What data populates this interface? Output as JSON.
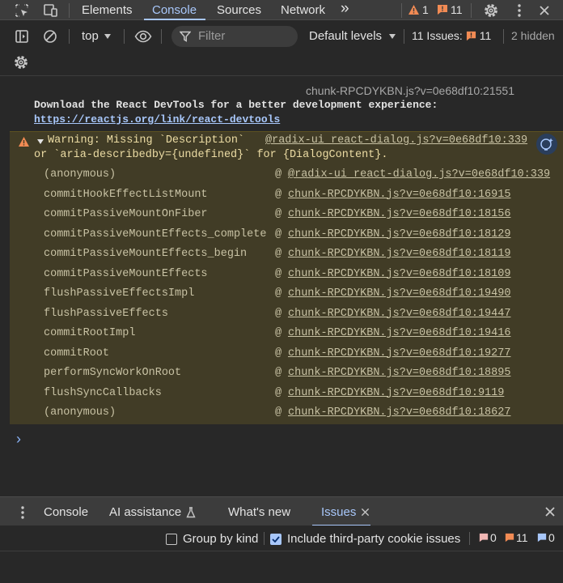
{
  "topbar": {
    "tabs": [
      {
        "label": "Elements"
      },
      {
        "label": "Console"
      },
      {
        "label": "Sources"
      },
      {
        "label": "Network"
      }
    ],
    "warning_count": "1",
    "issue_count": "11"
  },
  "console_toolbar": {
    "context": "top",
    "filter_placeholder": "Filter",
    "levels": "Default levels",
    "issues_label": "11 Issues:",
    "issues_count": "11",
    "hidden": "2 hidden"
  },
  "log": {
    "react_source": "chunk-RPCDYKBN.js?v=0e68df10:21551",
    "react_msg": "Download the React DevTools for a better development experience:",
    "react_link": "https://reactjs.org/link/react-devtools",
    "warning": {
      "line1": "Warning: Missing `Description`",
      "line2": "or `aria-describedby={undefined}` for {DialogContent}.",
      "source": "@radix-ui_react-dialog.js?v=0e68df10:339",
      "frames": [
        {
          "fn": "(anonymous)",
          "url": "@radix-ui_react-dialog.js?v=0e68df10:339"
        },
        {
          "fn": "commitHookEffectListMount",
          "url": "chunk-RPCDYKBN.js?v=0e68df10:16915"
        },
        {
          "fn": "commitPassiveMountOnFiber",
          "url": "chunk-RPCDYKBN.js?v=0e68df10:18156"
        },
        {
          "fn": "commitPassiveMountEffects_complete",
          "url": "chunk-RPCDYKBN.js?v=0e68df10:18129"
        },
        {
          "fn": "commitPassiveMountEffects_begin",
          "url": "chunk-RPCDYKBN.js?v=0e68df10:18119"
        },
        {
          "fn": "commitPassiveMountEffects",
          "url": "chunk-RPCDYKBN.js?v=0e68df10:18109"
        },
        {
          "fn": "flushPassiveEffectsImpl",
          "url": "chunk-RPCDYKBN.js?v=0e68df10:19490"
        },
        {
          "fn": "flushPassiveEffects",
          "url": "chunk-RPCDYKBN.js?v=0e68df10:19447"
        },
        {
          "fn": "commitRootImpl",
          "url": "chunk-RPCDYKBN.js?v=0e68df10:19416"
        },
        {
          "fn": "commitRoot",
          "url": "chunk-RPCDYKBN.js?v=0e68df10:19277"
        },
        {
          "fn": "performSyncWorkOnRoot",
          "url": "chunk-RPCDYKBN.js?v=0e68df10:18895"
        },
        {
          "fn": "flushSyncCallbacks",
          "url": "chunk-RPCDYKBN.js?v=0e68df10:9119"
        },
        {
          "fn": "(anonymous)",
          "url": "chunk-RPCDYKBN.js?v=0e68df10:18627"
        }
      ]
    },
    "prompt": "›"
  },
  "drawer": {
    "tabs": [
      {
        "label": "Console"
      },
      {
        "label": "AI assistance"
      },
      {
        "label": "What's new"
      },
      {
        "label": "Issues"
      }
    ],
    "group_by_kind": "Group by kind",
    "include_third_party": "Include third-party cookie issues",
    "counts": {
      "errors": "0",
      "warnings": "11",
      "info": "0"
    }
  },
  "colors": {
    "accent": "#a8c7fa",
    "warning_bg": "#413c26",
    "warning_icon": "#f28b54",
    "error": "#f2b8b5"
  }
}
